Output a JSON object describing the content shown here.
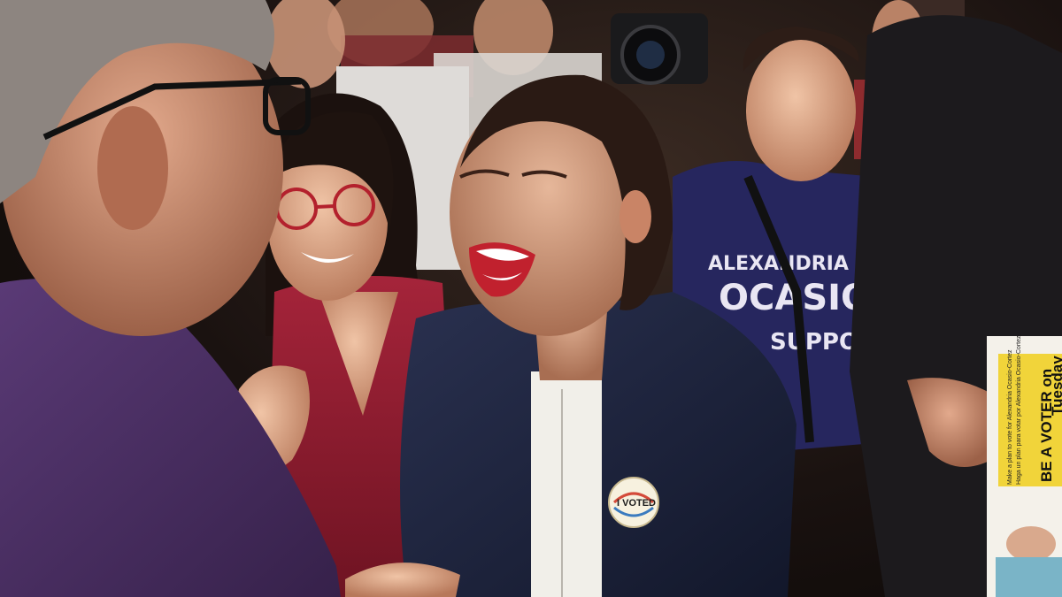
{
  "photo": {
    "shirt_text_line1": "ALEXANDRIA",
    "shirt_text_line2": "OCASIO",
    "shirt_text_line3": "SUPPORT",
    "pin_text": "I VOTED",
    "flyer_headline_1": "BE A VOTER on",
    "flyer_headline_2": "Tuesday",
    "flyer_small_1": "Make a plan to vote for Alexandria Ocasio-Cortez",
    "flyer_small_2": "Haga un plan para votar por Alexandria Ocasio-Cortez",
    "colors": {
      "background_dark": "#120d0b",
      "purple_shirt": "#4b2f63",
      "red_top": "#8d1b2a",
      "navy_blazer": "#1c2236",
      "campaign_shirt": "#2a2a66",
      "flyer_yellow": "#f1d43a"
    }
  }
}
